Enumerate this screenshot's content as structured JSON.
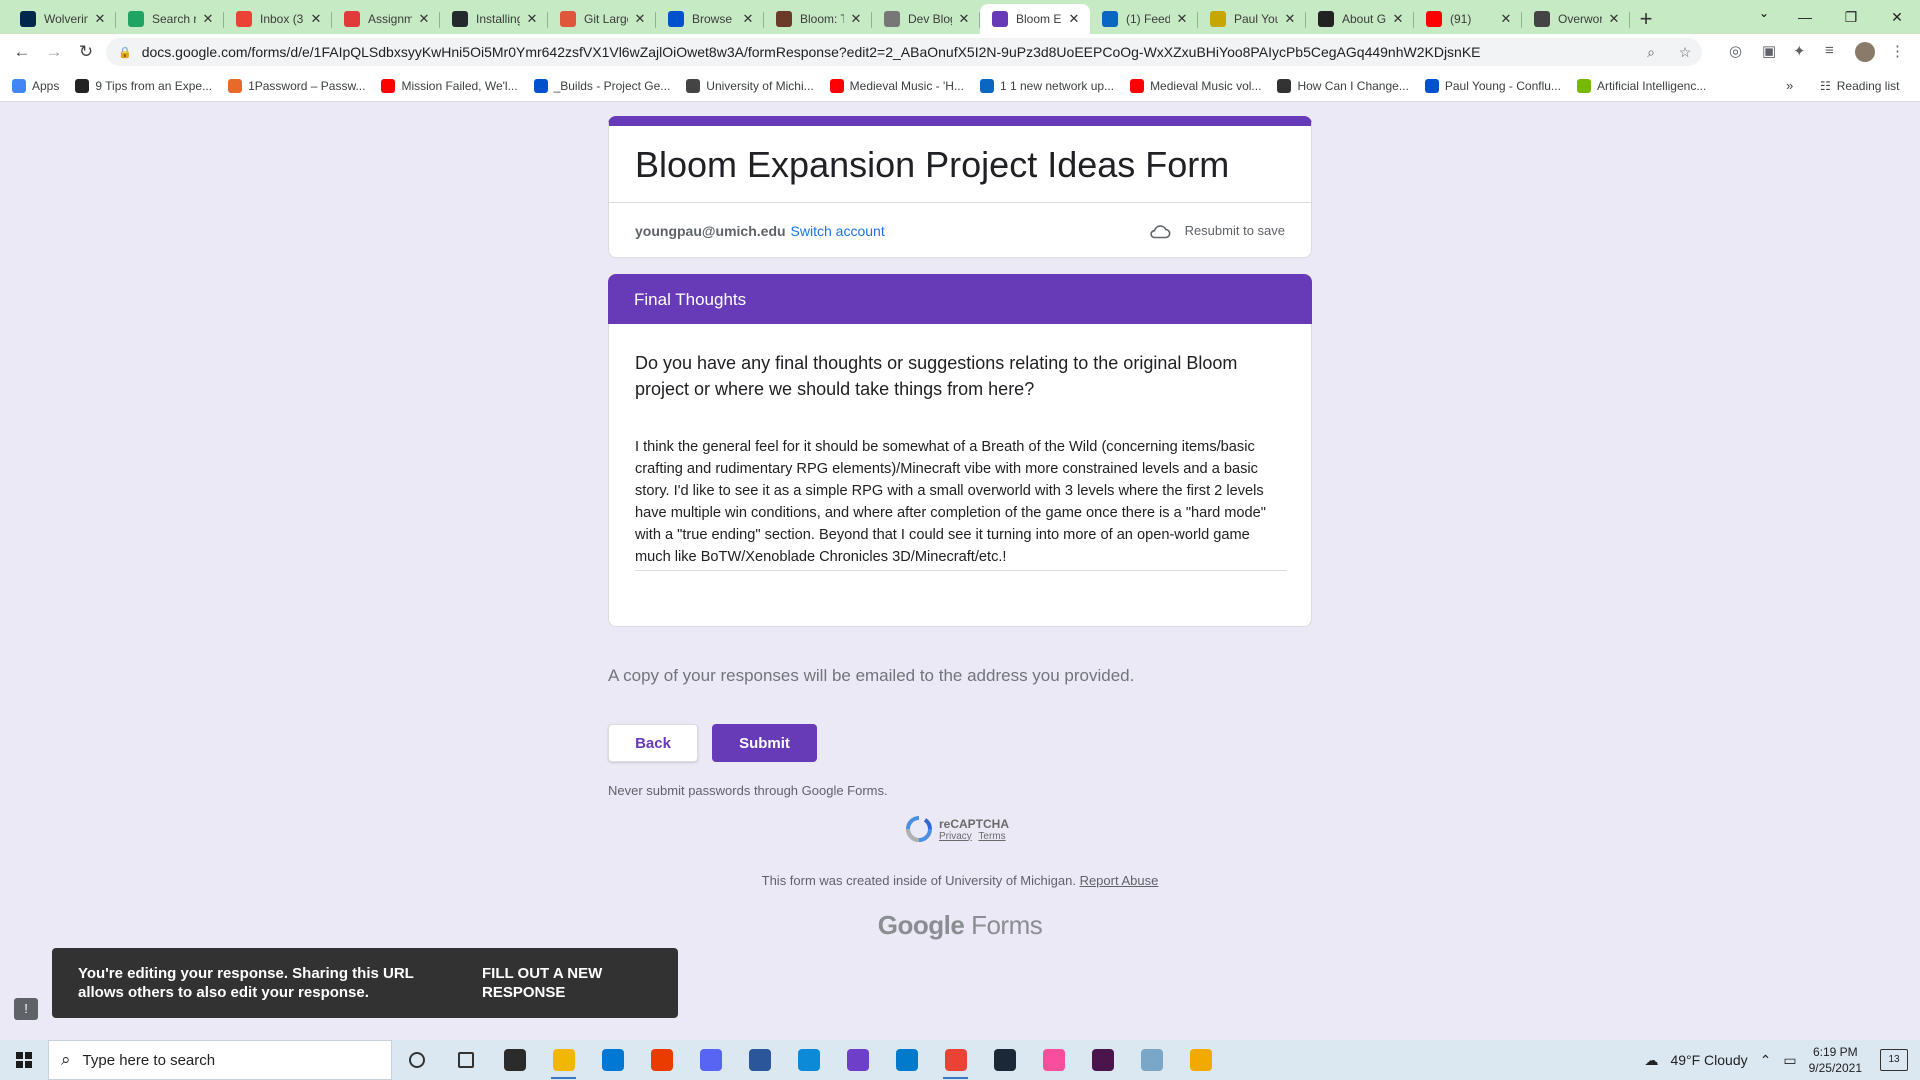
{
  "browser": {
    "tabs": [
      {
        "title": "Wolverin",
        "icon": "m-icon",
        "color": "#00274c"
      },
      {
        "title": "Search re",
        "icon": "drive-icon",
        "color": "#1fa463"
      },
      {
        "title": "Inbox (3",
        "icon": "gmail-icon",
        "color": "#ea4335"
      },
      {
        "title": "Assignm",
        "icon": "canvas-icon",
        "color": "#e13a3a"
      },
      {
        "title": "Installing",
        "icon": "github-icon",
        "color": "#24292e"
      },
      {
        "title": "Git Large",
        "icon": "git-icon",
        "color": "#e0563b"
      },
      {
        "title": "Browse F",
        "icon": "confluence-icon",
        "color": "#0052cc"
      },
      {
        "title": "Bloom: T",
        "icon": "bloom-icon",
        "color": "#6b3b2a"
      },
      {
        "title": "Dev Blog",
        "icon": "globe-icon",
        "color": "#777777"
      },
      {
        "title": "Bloom E",
        "icon": "forms-icon",
        "color": "#673ab7"
      },
      {
        "title": "(1) Feed",
        "icon": "linkedin-icon",
        "color": "#0a66c2"
      },
      {
        "title": "Paul You",
        "icon": "bookmark-icon",
        "color": "#c8a600"
      },
      {
        "title": "About G",
        "icon": "dev-icon",
        "color": "#222222"
      },
      {
        "title": "(91)",
        "icon": "youtube-icon",
        "color": "#ff0000"
      },
      {
        "title": "Overwor",
        "icon": "wikipedia-icon",
        "color": "#444444"
      }
    ],
    "url": "docs.google.com/forms/d/e/1FAIpQLSdbxsyyKwHni5Oi5Mr0Ymr642zsfVX1Vl6wZajlOiOwet8w3A/formResponse?edit2=2_ABaOnufX5I2N-9uPz3d8UoEEPCoOg-WxXZxuBHiYoo8PAIycPb5CegAGq449nhW2KDjsnKE",
    "bookmarks": [
      {
        "label": "Apps",
        "color": "#4285f4"
      },
      {
        "label": "9 Tips from an Expe...",
        "color": "#222222"
      },
      {
        "label": "1Password – Passw...",
        "color": "#e86a2b"
      },
      {
        "label": "Mission Failed, We'l...",
        "color": "#ff0000"
      },
      {
        "label": "_Builds - Project Ge...",
        "color": "#0052cc"
      },
      {
        "label": "University of Michi...",
        "color": "#444444"
      },
      {
        "label": "Medieval Music - 'H...",
        "color": "#ff0000"
      },
      {
        "label": "1 1 new network up...",
        "color": "#0a66c2"
      },
      {
        "label": "Medieval Music vol...",
        "color": "#ff0000"
      },
      {
        "label": "How Can I Change...",
        "color": "#333333"
      },
      {
        "label": "Paul Young - Conflu...",
        "color": "#0052cc"
      },
      {
        "label": "Artificial Intelligenc...",
        "color": "#76b900"
      }
    ],
    "reading_list": "Reading list"
  },
  "form": {
    "title": "Bloom Expansion Project Ideas Form",
    "account_email": "youngpau@umich.edu",
    "switch_account": "Switch account",
    "resubmit_note": "Resubmit to save",
    "section_title": "Final Thoughts",
    "question": "Do you have any final thoughts or suggestions relating to the original Bloom project or where we should take things from here?",
    "answer": "I think the general feel for it should be somewhat of a Breath of the Wild (concerning items/basic crafting and rudimentary RPG elements)/Minecraft vibe with more constrained levels and a basic story. I'd like to see it as a simple RPG with a small overworld with 3 levels where the first 2 levels have multiple win conditions, and where after completion of the game once there is a \"hard mode\" with a \"true ending\" section. Beyond that I could see it turning into more of an open-world game much like BoTW/Xenoblade Chronicles 3D/Minecraft/etc.!",
    "copy_note": "A copy of your responses will be emailed to the address you provided.",
    "back_label": "Back",
    "submit_label": "Submit",
    "password_note": "Never submit passwords through Google Forms.",
    "recaptcha_title": "reCAPTCHA",
    "recaptcha_privacy": "Privacy",
    "recaptcha_terms": "Terms",
    "created_note": "This form was created inside of University of Michigan.",
    "report_abuse": "Report Abuse",
    "footer_google": "Google",
    "footer_forms": "Forms",
    "accent_color": "#673ab7"
  },
  "snackbar": {
    "message": "You're editing your response. Sharing this URL allows others to also edit your response.",
    "action": "Fill out a new response"
  },
  "taskbar": {
    "search_placeholder": "Type here to search",
    "apps": [
      {
        "icon": "cortana-icon",
        "color": "#333333"
      },
      {
        "icon": "task-view-icon",
        "color": "#333333"
      },
      {
        "icon": "store-icon",
        "color": "#2b2b2b"
      },
      {
        "icon": "file-explorer-icon",
        "color": "#f2b705"
      },
      {
        "icon": "mail-icon",
        "color": "#0078d4"
      },
      {
        "icon": "office-icon",
        "color": "#eb3c00"
      },
      {
        "icon": "discord-icon",
        "color": "#5865f2"
      },
      {
        "icon": "word-icon",
        "color": "#2b579a"
      },
      {
        "icon": "edge-icon",
        "color": "#0c8ad8"
      },
      {
        "icon": "github-desktop-icon",
        "color": "#6e40c9"
      },
      {
        "icon": "vscode-icon",
        "color": "#007acc"
      },
      {
        "icon": "chrome-icon",
        "color": "#ea4335"
      },
      {
        "icon": "steam-icon",
        "color": "#1b2838"
      },
      {
        "icon": "itunes-icon",
        "color": "#f74f9e"
      },
      {
        "icon": "slack-icon",
        "color": "#4a154b"
      },
      {
        "icon": "onenote-icon",
        "color": "#7aa7c7"
      },
      {
        "icon": "chrome-canary-icon",
        "color": "#f2a900"
      }
    ],
    "weather": "49°F  Cloudy",
    "time": "6:19 PM",
    "date": "9/25/2021",
    "notifications": "13"
  }
}
